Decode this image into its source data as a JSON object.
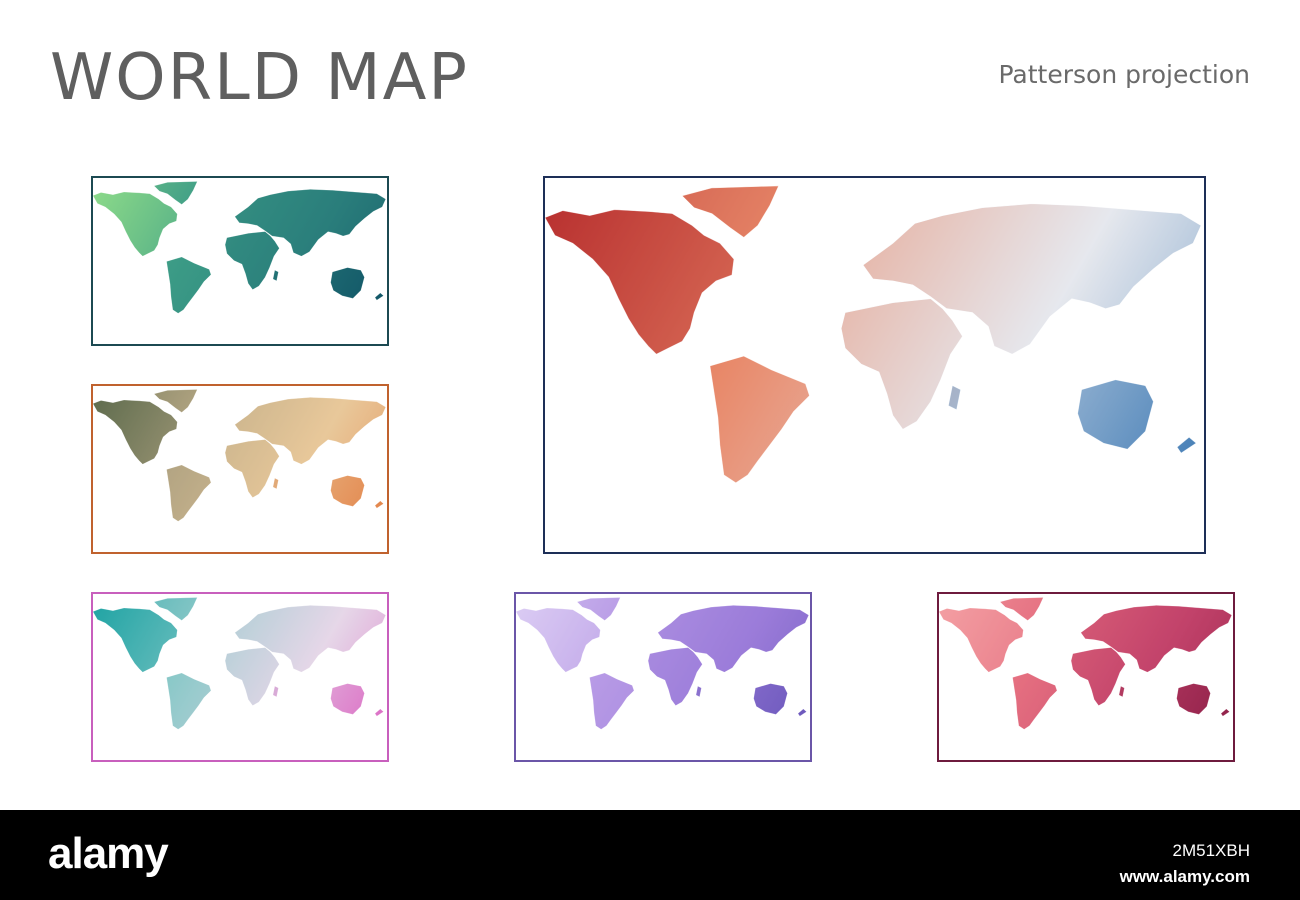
{
  "header": {
    "title": "WORLD MAP",
    "subtitle": "Patterson projection"
  },
  "maps": [
    {
      "id": "main",
      "palette": [
        "#b72e2e",
        "#e8896a",
        "#e6e8ee",
        "#2e6fae"
      ],
      "border_color": "#1d2f57"
    },
    {
      "id": "green",
      "palette": [
        "#8fdc8a",
        "#3c9c86",
        "#2a7e7c",
        "#0e4f63"
      ],
      "border_color": "#1c4a52"
    },
    {
      "id": "olive-orange",
      "palette": [
        "#5d6b4c",
        "#b5a684",
        "#e9c89a",
        "#e27a3f"
      ],
      "border_color": "#c0622e"
    },
    {
      "id": "teal-pink",
      "palette": [
        "#1ea3a3",
        "#8cc9c9",
        "#e6d7e8",
        "#d95fc0"
      ],
      "border_color": "#c85fbd"
    },
    {
      "id": "lavender-violet",
      "palette": [
        "#dccdf4",
        "#b79ae6",
        "#9b7cd9",
        "#6552b8"
      ],
      "border_color": "#6b56a8"
    },
    {
      "id": "pink-crimson",
      "palette": [
        "#f4a0a4",
        "#e56f80",
        "#c2436b",
        "#8a1d45"
      ],
      "border_color": "#6e1b3e"
    }
  ],
  "watermark": {
    "logo": "alamy",
    "image_id": "2M51XBH",
    "url": "www.alamy.com"
  }
}
